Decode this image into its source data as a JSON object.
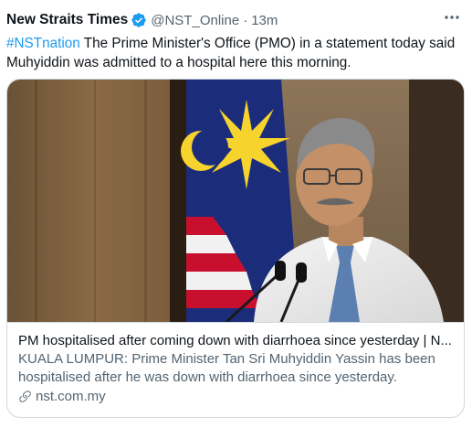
{
  "tweet": {
    "author_name": "New Straits Times",
    "handle": "@NST_Online",
    "separator": "·",
    "time": "13m",
    "hashtag": "#NSTnation",
    "text": " The Prime Minister's Office (PMO) in a statement today said Muhyiddin was admitted to a hospital here this morning."
  },
  "card": {
    "title": "PM hospitalised after coming down with diarrhoea since yesterday | N...",
    "description": "KUALA LUMPUR: Prime Minister Tan Sri Muhyiddin Yassin has been hospitalised after he was down with diarrhoea since yesterday.",
    "domain": "nst.com.my"
  },
  "icons": {
    "verified": "verified-badge-icon",
    "more": "more-options-icon",
    "link": "link-icon"
  },
  "colors": {
    "accent": "#1d9bf0",
    "text": "#0f1419",
    "secondary": "#536471",
    "border": "#cfd9de"
  }
}
